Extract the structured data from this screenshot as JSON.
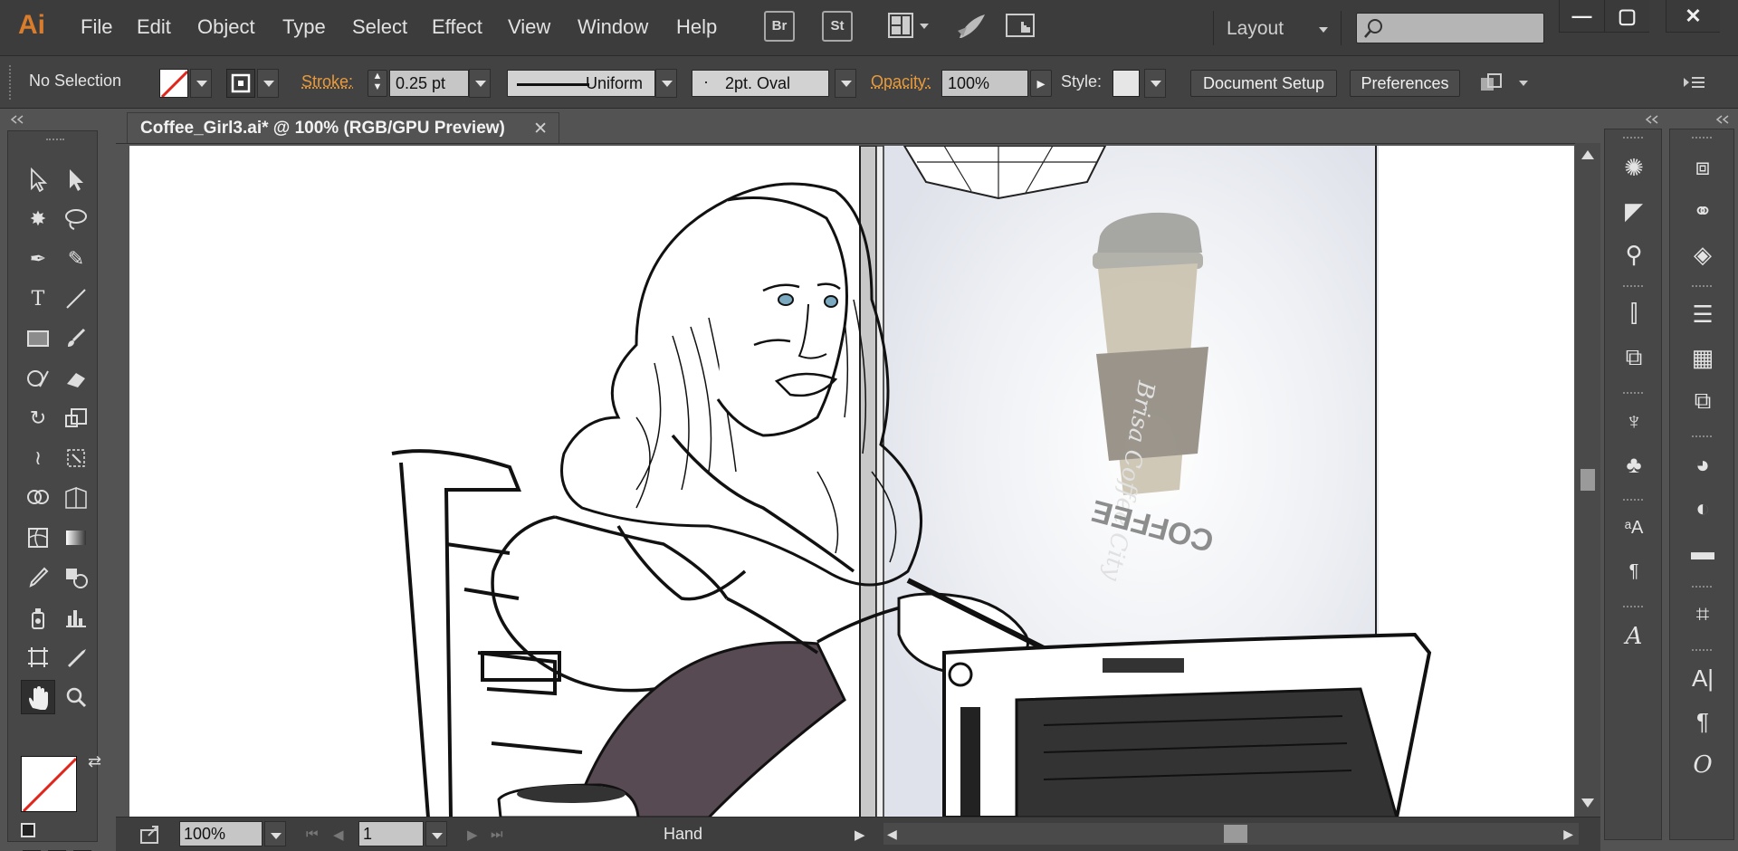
{
  "app": {
    "logo": "Ai",
    "accent": "#d97d2c"
  },
  "menu": {
    "items": [
      "File",
      "Edit",
      "Object",
      "Type",
      "Select",
      "Effect",
      "View",
      "Window",
      "Help"
    ],
    "bridge": "Br",
    "stock": "St",
    "workspace": "Layout",
    "search_placeholder": "",
    "window_controls": [
      "minimize-icon",
      "restore-icon",
      "close-icon"
    ]
  },
  "control": {
    "selection": "No Selection",
    "stroke_label": "Stroke:",
    "stroke_weight": "0.25 pt",
    "profile": "Uniform",
    "brush": "2pt. Oval",
    "opacity_label": "Opacity:",
    "opacity_value": "100%",
    "style_label": "Style:",
    "document_setup": "Document Setup",
    "preferences": "Preferences"
  },
  "document": {
    "tab_title": "Coffee_Girl3.ai* @ 100% (RGB/GPU Preview)",
    "cup_text": "COFFEE",
    "cup_script": "Brisa Coffee City"
  },
  "status": {
    "zoom": "100%",
    "artboard": "1",
    "tool": "Hand"
  },
  "colors": {
    "ui_dark": "#3c3c3c",
    "ui_panel": "#535353",
    "sweater": "#574a52",
    "cup": "#b8b0a0"
  }
}
